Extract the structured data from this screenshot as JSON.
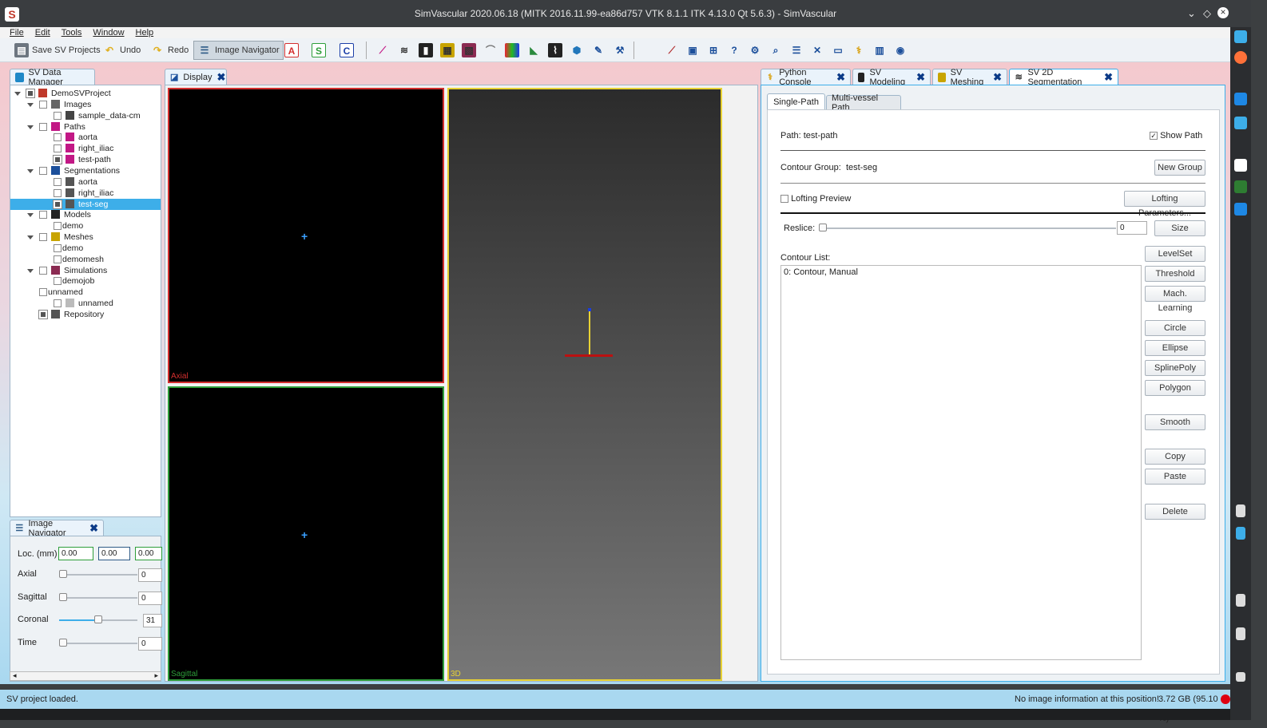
{
  "window": {
    "title": "SimVascular 2020.06.18 (MITK 2016.11.99-ea86d757 VTK 8.1.1 ITK 4.13.0 Qt 5.6.3) - SimVascular",
    "min": "⌄",
    "max": "◇",
    "close": "×"
  },
  "menu": [
    "File",
    "Edit",
    "Tools",
    "Window",
    "Help"
  ],
  "toolbar": {
    "save": "Save SV Projects",
    "undo": "Undo",
    "redo": "Redo",
    "image_nav": "Image Navigator",
    "a": "A",
    "s": "S",
    "c": "C"
  },
  "data_manager": {
    "tab": "SV Data Manager",
    "items": [
      {
        "label": "DemoSVProject",
        "depth": 0
      },
      {
        "label": "Images",
        "depth": 1
      },
      {
        "label": "sample_data-cm",
        "depth": 2
      },
      {
        "label": "Paths",
        "depth": 1
      },
      {
        "label": "aorta",
        "depth": 2
      },
      {
        "label": "right_iliac",
        "depth": 2
      },
      {
        "label": "test-path",
        "depth": 2
      },
      {
        "label": "Segmentations",
        "depth": 1
      },
      {
        "label": "aorta",
        "depth": 2
      },
      {
        "label": "right_iliac",
        "depth": 2
      },
      {
        "label": "test-seg",
        "depth": 2
      },
      {
        "label": "Models",
        "depth": 1
      },
      {
        "label": "demo",
        "depth": 2
      },
      {
        "label": "Meshes",
        "depth": 1
      },
      {
        "label": "demo",
        "depth": 2
      },
      {
        "label": "demomesh",
        "depth": 2
      },
      {
        "label": "Simulations",
        "depth": 1
      },
      {
        "label": "demojob",
        "depth": 2
      },
      {
        "label": "unnamed",
        "depth": 1
      },
      {
        "label": "unnamed",
        "depth": 2
      },
      {
        "label": "Repository",
        "depth": 1
      }
    ]
  },
  "image_navigator": {
    "tab": "Image Navigator",
    "loc_label": "Loc. (mm)",
    "loc_values": [
      "0.00",
      "0.00",
      "0.00"
    ],
    "rows": [
      {
        "label": "Axial",
        "value": "0",
        "level": 0
      },
      {
        "label": "Sagittal",
        "value": "0",
        "level": 0
      },
      {
        "label": "Coronal",
        "value": "31",
        "level": 0.5
      },
      {
        "label": "Time",
        "value": "0",
        "level": 0
      }
    ]
  },
  "display": {
    "tab": "Display",
    "views": {
      "axial": "Axial",
      "sagittal": "Sagittal",
      "three_d": "3D"
    }
  },
  "right_tabs": [
    "Python Console",
    "SV Modeling",
    "SV Meshing",
    "SV 2D Segmentation"
  ],
  "segmentation": {
    "subtabs": [
      "Single-Path",
      "Multi-vessel Path"
    ],
    "path_label": "Path:",
    "path_value": "test-path",
    "show_path": "Show Path",
    "group_label": "Contour Group:",
    "group_value": "test-seg",
    "new_group": "New Group",
    "lofting_preview": "Lofting Preview",
    "lofting_params": "Lofting Parameters...",
    "reslice_label": "Reslice:",
    "reslice_value": "0",
    "size": "Size",
    "contour_list_label": "Contour List:",
    "contours": [
      "0: Contour, Manual"
    ],
    "buttons": [
      "LevelSet",
      "Threshold",
      "Mach. Learning",
      "Circle",
      "Ellipse",
      "SplinePoly",
      "Polygon",
      "Smooth",
      "Copy",
      "Paste",
      "Delete"
    ]
  },
  "status": {
    "left": "SV project loaded.",
    "right": "No image information at this position!",
    "mem": "3.72 GB (95.10 %)"
  },
  "colors": {
    "axial": "#d32f2f",
    "sagittal": "#2e9e3a",
    "three_d": "#e8d234",
    "accent": "#3daee9"
  }
}
